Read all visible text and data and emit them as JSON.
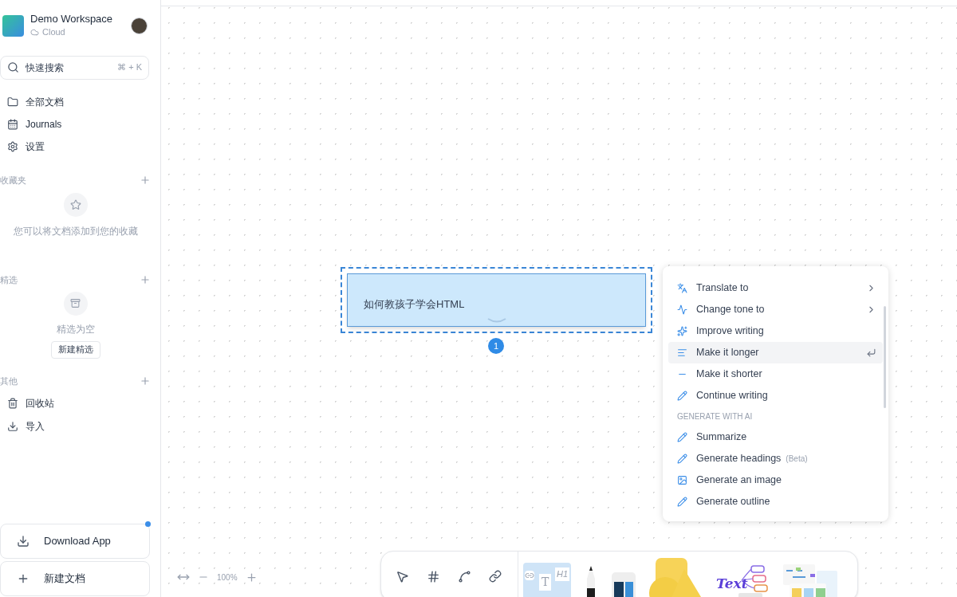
{
  "workspace": {
    "name": "Demo Workspace",
    "storage": "Cloud"
  },
  "search": {
    "placeholder": "快速搜索",
    "shortcut": "⌘ + K"
  },
  "nav": [
    {
      "label": "全部文档",
      "selected": false
    },
    {
      "label": "Journals",
      "selected": false
    },
    {
      "label": "设置",
      "selected": false
    }
  ],
  "favorites": {
    "title": "收藏夹",
    "empty_text": "您可以将文档添加到您的收藏"
  },
  "collections": {
    "title": "精选",
    "empty_text": "精选为空",
    "button": "新建精选"
  },
  "others": {
    "title": "其他",
    "items": [
      {
        "label": "回收站"
      },
      {
        "label": "导入"
      }
    ]
  },
  "download_app": {
    "label": "Download App",
    "badge": true
  },
  "new_doc": {
    "label": "新建文档"
  },
  "canvas": {
    "block_text": "如何教孩子学会HTML",
    "selection_index": "1",
    "zoom": "100%"
  },
  "ai_menu": {
    "sections": [
      {
        "items": [
          {
            "label": "Translate to",
            "submenu": true,
            "selected": false
          },
          {
            "label": "Change tone to",
            "submenu": true,
            "selected": false
          },
          {
            "label": "Improve writing",
            "submenu": false,
            "selected": false
          },
          {
            "label": "Make it longer",
            "submenu": false,
            "selected": true
          },
          {
            "label": "Make it shorter",
            "submenu": false,
            "selected": false
          },
          {
            "label": "Continue writing",
            "submenu": false,
            "selected": false
          }
        ]
      },
      {
        "title": "GENERATE WITH AI",
        "items": [
          {
            "label": "Summarize",
            "submenu": false,
            "selected": false
          },
          {
            "label": "Generate headings",
            "tag": "(Beta)",
            "submenu": false,
            "selected": false
          },
          {
            "label": "Generate an image",
            "submenu": false,
            "selected": false
          },
          {
            "label": "Generate outline",
            "submenu": false,
            "selected": false
          }
        ]
      }
    ]
  },
  "toolbar": {
    "note_labels": [
      "T",
      "H1"
    ],
    "mindmap_label": "Text"
  }
}
